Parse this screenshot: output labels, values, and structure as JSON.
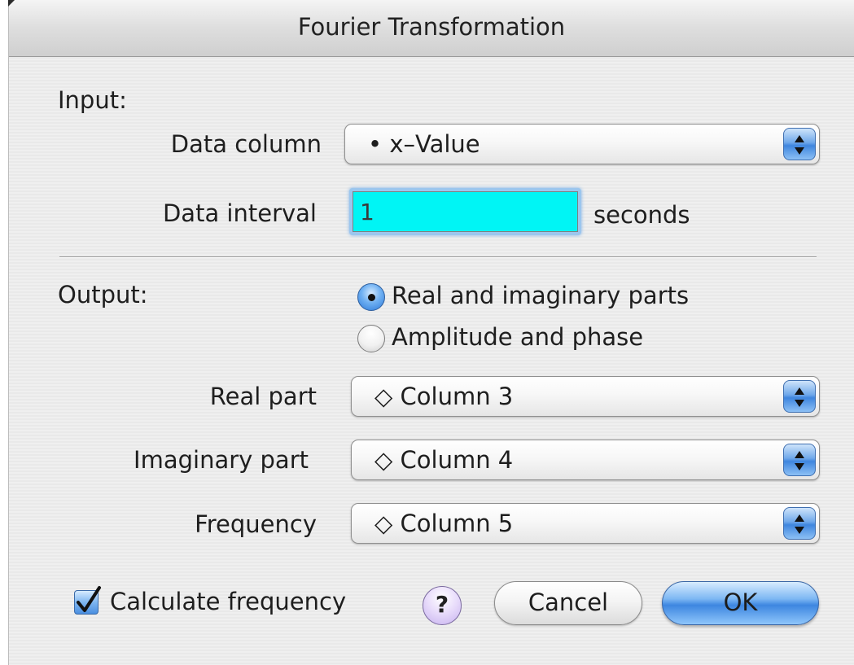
{
  "window": {
    "title": "Fourier Transformation"
  },
  "input": {
    "section_label": "Input:",
    "data_column": {
      "label": "Data column",
      "value": "• x–Value"
    },
    "data_interval": {
      "label": "Data interval",
      "value": "1",
      "unit": "seconds"
    }
  },
  "output": {
    "section_label": "Output:",
    "mode_options": [
      {
        "label": "Real and imaginary parts",
        "selected": true
      },
      {
        "label": "Amplitude and phase",
        "selected": false
      }
    ],
    "real_part": {
      "label": "Real part",
      "value": "◇ Column 3"
    },
    "imaginary_part": {
      "label": "Imaginary part",
      "value": "◇ Column 4"
    },
    "frequency": {
      "label": "Frequency",
      "value": "◇ Column 5"
    }
  },
  "footer": {
    "calculate_frequency": {
      "label": "Calculate frequency",
      "checked": true
    },
    "help_label": "?",
    "cancel_label": "Cancel",
    "ok_label": "OK"
  },
  "colors": {
    "field_highlight": "#00f5f5",
    "aqua_blue": "#3d86e0",
    "help_purple": "#c7b2ef"
  }
}
